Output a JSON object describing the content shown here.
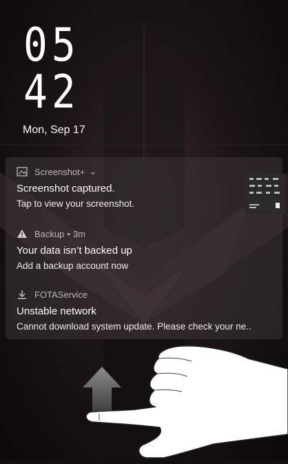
{
  "clock": {
    "hours": "05",
    "minutes": "42"
  },
  "date": "Mon, Sep 17",
  "notifications": [
    {
      "app": "Screenshot+",
      "icon": "image-icon",
      "chevron": "⌄",
      "time": "",
      "title": "Screenshot captured.",
      "text": "Tap to view your screenshot."
    },
    {
      "app": "Backup",
      "icon": "warning-icon",
      "time": "3m",
      "title": "Your data isn’t backed up",
      "text": "Add a backup account now"
    },
    {
      "app": "FOTAService",
      "icon": "download-icon",
      "time": "",
      "title": "Unstable network",
      "text": "Cannot download system update. Please check your ne.."
    }
  ],
  "gesture": {
    "icon": "swipe-up-hand-icon",
    "arrow": "arrow-up-icon"
  }
}
